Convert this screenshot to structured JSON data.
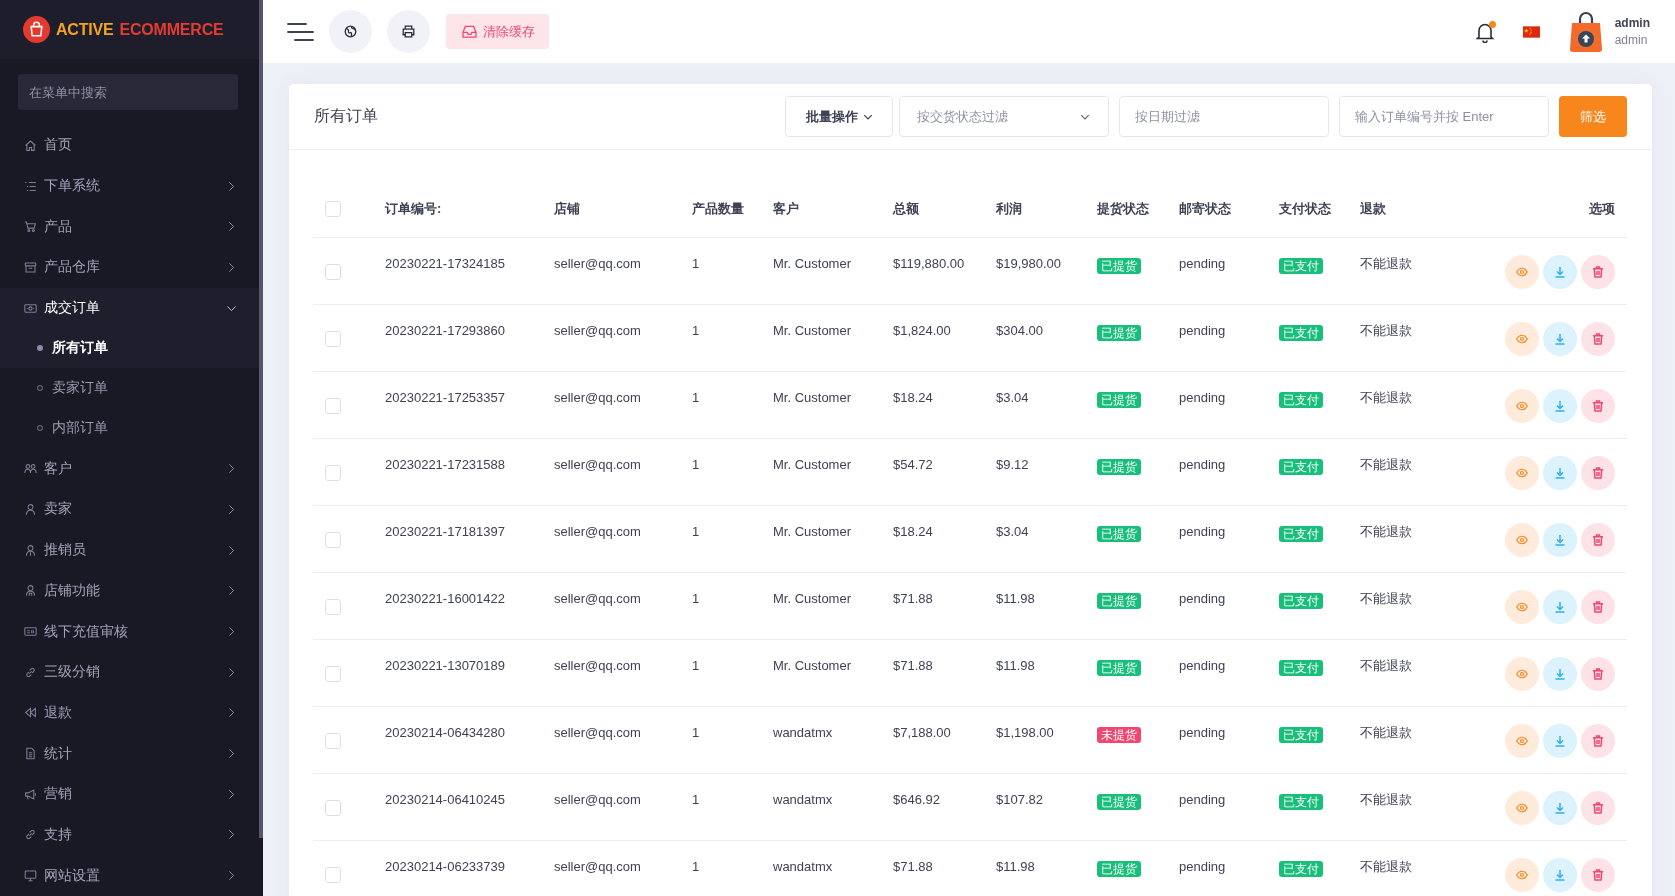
{
  "sidebar": {
    "logo": {
      "words": [
        "ACTIVE",
        "ECOMMERCE"
      ]
    },
    "search": {
      "placeholder": "在菜单中搜索"
    },
    "items": [
      {
        "label": "首页",
        "kind": "link"
      },
      {
        "label": "下单系统",
        "kind": "group",
        "expanded": false
      },
      {
        "label": "产品",
        "kind": "group",
        "expanded": false
      },
      {
        "label": "产品仓库",
        "kind": "group",
        "expanded": false
      },
      {
        "label": "成交订单",
        "kind": "group",
        "expanded": true,
        "children": [
          {
            "label": "所有订单",
            "selected": true
          },
          {
            "label": "卖家订单",
            "selected": false
          },
          {
            "label": "内部订单",
            "selected": false
          }
        ]
      },
      {
        "label": "客户",
        "kind": "group",
        "expanded": false
      },
      {
        "label": "卖家",
        "kind": "group",
        "expanded": false
      },
      {
        "label": "推销员",
        "kind": "group",
        "expanded": false
      },
      {
        "label": "店铺功能",
        "kind": "group",
        "expanded": false
      },
      {
        "label": "线下充值审核",
        "kind": "group",
        "expanded": false
      },
      {
        "label": "三级分销",
        "kind": "group",
        "expanded": false
      },
      {
        "label": "退款",
        "kind": "group",
        "expanded": false
      },
      {
        "label": "统计",
        "kind": "group",
        "expanded": false
      },
      {
        "label": "营销",
        "kind": "group",
        "expanded": false
      },
      {
        "label": "支持",
        "kind": "group",
        "expanded": false
      },
      {
        "label": "网站设置",
        "kind": "group",
        "expanded": false
      }
    ]
  },
  "topbar": {
    "clear_cache": {
      "label": "清除缓存"
    },
    "notifications": {
      "unread": true
    },
    "user": {
      "name": "admin",
      "role": "admin"
    }
  },
  "orders": {
    "title": "所有订单",
    "bulk_action": {
      "label": "批量操作"
    },
    "delivery_filter": {
      "placeholder": "按交货状态过滤"
    },
    "date_filter": {
      "placeholder": "按日期过滤"
    },
    "search": {
      "placeholder": "输入订单编号并按 Enter"
    },
    "filter_button": {
      "label": "筛选"
    },
    "table": {
      "select_all": {
        "checked": false
      },
      "columns": [
        "订单编号:",
        "店铺",
        "产品数量",
        "客户",
        "总额",
        "利润",
        "提货状态",
        "邮寄状态",
        "支付状态",
        "退款",
        "选项"
      ],
      "rows": [
        {
          "checked": false,
          "order_code": "20230221-17324185",
          "shop": "seller@qq.com",
          "quantity": "1",
          "customer": "Mr. Customer",
          "amount": "$119,880.00",
          "profit": "$19,980.00",
          "delivery": {
            "label": "已提货",
            "kind": "success"
          },
          "shipping": "pending",
          "payment": {
            "label": "已支付",
            "kind": "success"
          },
          "refund": "不能退款"
        },
        {
          "checked": false,
          "order_code": "20230221-17293860",
          "shop": "seller@qq.com",
          "quantity": "1",
          "customer": "Mr. Customer",
          "amount": "$1,824.00",
          "profit": "$304.00",
          "delivery": {
            "label": "已提货",
            "kind": "success"
          },
          "shipping": "pending",
          "payment": {
            "label": "已支付",
            "kind": "success"
          },
          "refund": "不能退款"
        },
        {
          "checked": false,
          "order_code": "20230221-17253357",
          "shop": "seller@qq.com",
          "quantity": "1",
          "customer": "Mr. Customer",
          "amount": "$18.24",
          "profit": "$3.04",
          "delivery": {
            "label": "已提货",
            "kind": "success"
          },
          "shipping": "pending",
          "payment": {
            "label": "已支付",
            "kind": "success"
          },
          "refund": "不能退款"
        },
        {
          "checked": false,
          "order_code": "20230221-17231588",
          "shop": "seller@qq.com",
          "quantity": "1",
          "customer": "Mr. Customer",
          "amount": "$54.72",
          "profit": "$9.12",
          "delivery": {
            "label": "已提货",
            "kind": "success"
          },
          "shipping": "pending",
          "payment": {
            "label": "已支付",
            "kind": "success"
          },
          "refund": "不能退款"
        },
        {
          "checked": false,
          "order_code": "20230221-17181397",
          "shop": "seller@qq.com",
          "quantity": "1",
          "customer": "Mr. Customer",
          "amount": "$18.24",
          "profit": "$3.04",
          "delivery": {
            "label": "已提货",
            "kind": "success"
          },
          "shipping": "pending",
          "payment": {
            "label": "已支付",
            "kind": "success"
          },
          "refund": "不能退款"
        },
        {
          "checked": false,
          "order_code": "20230221-16001422",
          "shop": "seller@qq.com",
          "quantity": "1",
          "customer": "Mr. Customer",
          "amount": "$71.88",
          "profit": "$11.98",
          "delivery": {
            "label": "已提货",
            "kind": "success"
          },
          "shipping": "pending",
          "payment": {
            "label": "已支付",
            "kind": "success"
          },
          "refund": "不能退款"
        },
        {
          "checked": false,
          "order_code": "20230221-13070189",
          "shop": "seller@qq.com",
          "quantity": "1",
          "customer": "Mr. Customer",
          "amount": "$71.88",
          "profit": "$11.98",
          "delivery": {
            "label": "已提货",
            "kind": "success"
          },
          "shipping": "pending",
          "payment": {
            "label": "已支付",
            "kind": "success"
          },
          "refund": "不能退款"
        },
        {
          "checked": false,
          "order_code": "20230214-06434280",
          "shop": "seller@qq.com",
          "quantity": "1",
          "customer": "wandatmx",
          "amount": "$7,188.00",
          "profit": "$1,198.00",
          "delivery": {
            "label": "未提货",
            "kind": "danger"
          },
          "shipping": "pending",
          "payment": {
            "label": "已支付",
            "kind": "success"
          },
          "refund": "不能退款"
        },
        {
          "checked": false,
          "order_code": "20230214-06410245",
          "shop": "seller@qq.com",
          "quantity": "1",
          "customer": "wandatmx",
          "amount": "$646.92",
          "profit": "$107.82",
          "delivery": {
            "label": "已提货",
            "kind": "success"
          },
          "shipping": "pending",
          "payment": {
            "label": "已支付",
            "kind": "success"
          },
          "refund": "不能退款"
        },
        {
          "checked": false,
          "order_code": "20230214-06233739",
          "shop": "seller@qq.com",
          "quantity": "1",
          "customer": "wandatmx",
          "amount": "$71.88",
          "profit": "$11.98",
          "delivery": {
            "label": "已提货",
            "kind": "success"
          },
          "shipping": "pending",
          "payment": {
            "label": "已支付",
            "kind": "success"
          },
          "refund": "不能退款"
        }
      ]
    }
  }
}
